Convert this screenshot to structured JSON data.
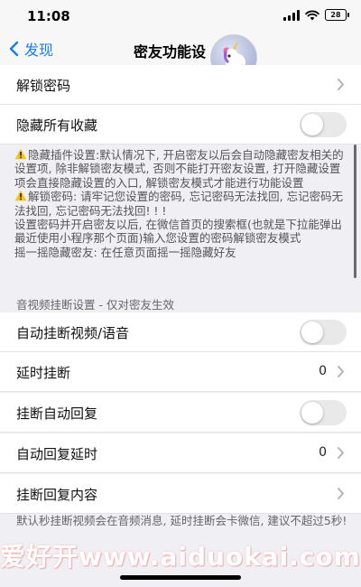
{
  "status": {
    "time": "11:08",
    "battery": "28"
  },
  "nav": {
    "back_label": "发现",
    "title": "密友功能设"
  },
  "rows": {
    "unlock_password": "解锁密码",
    "hide_favorites": "隐藏所有收藏",
    "auto_hangup": "自动挂断视频/语音",
    "delay_hangup": "延时挂断",
    "delay_hangup_value": "0",
    "hangup_auto_reply": "挂断自动回复",
    "auto_reply_delay": "自动回复延时",
    "auto_reply_delay_value": "0",
    "hangup_reply_content": "挂断回复内容"
  },
  "info": {
    "line1": "隐藏插件设置:默认情况下, 开启密友以后会自动隐藏密友相关的设置项, 除非解锁密友模式, 否则不能打开密友设置, 打开隐藏设置项会直接隐藏设置的入口, 解锁密友模式才能进行功能设置",
    "line2": "解锁密码: 请牢记您设置的密码, 忘记密码无法找回, 忘记密码无法找回, 忘记密码无法找回! ! !",
    "line3": "设置密码并开启密友以后, 在微信首页的搜索框(也就是下拉能弹出最近使用小程序那个页面)输入您设置的密码解锁密友模式",
    "line4": "摇一摇隐藏密友: 在任意页面摇一摇隐藏好友"
  },
  "section_header": "音视频挂断设置 - 仅对密友生效",
  "footer_note": "默认秒挂断视频会在音频消息, 延时挂断会卡微信, 建议不超过5秒!",
  "watermark": "爱好开www.aiduokai.com",
  "colors": {
    "accent": "#1a7cf5",
    "background": "#efeff4",
    "toggle_off": "#e9e9ea"
  },
  "toggles": {
    "hide_favorites": false,
    "auto_hangup": false,
    "hangup_auto_reply": false
  }
}
